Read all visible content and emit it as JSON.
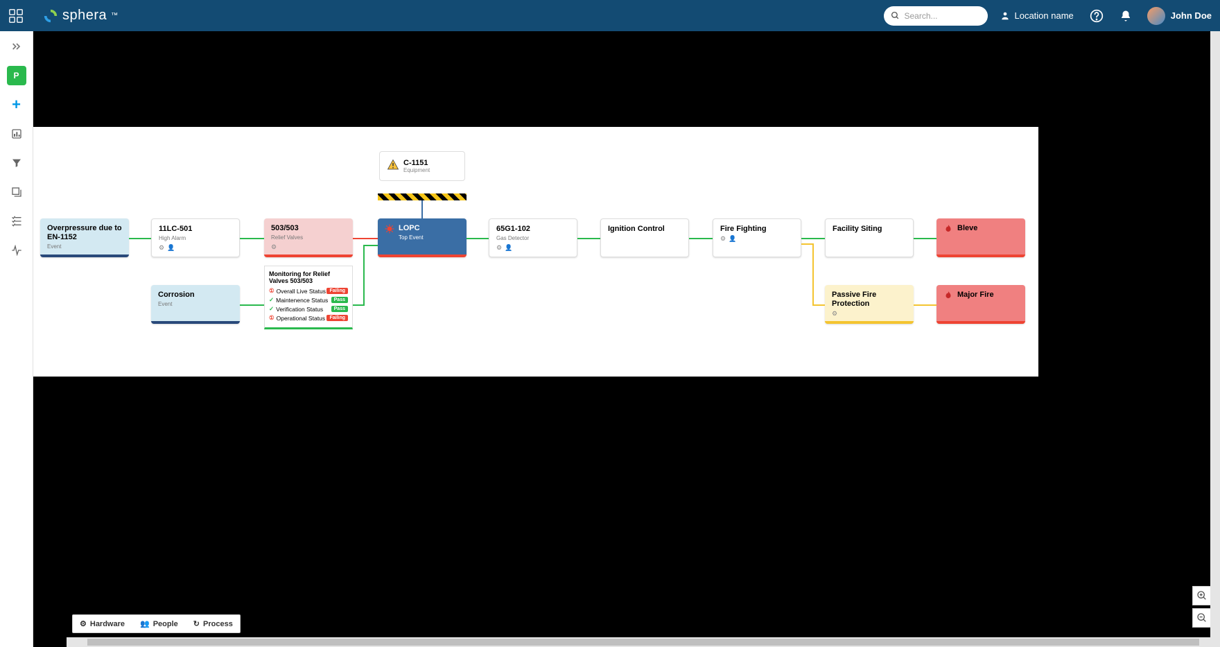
{
  "header": {
    "brand": "sphera",
    "search_placeholder": "Search...",
    "location": "Location name",
    "user": "John Doe"
  },
  "sidebar": {
    "p_label": "P"
  },
  "equipment": {
    "title": "C-1151",
    "subtitle": "Equipment"
  },
  "nodes": {
    "overpressure": {
      "title": "Overpressure due to EN-1152",
      "sub": "Event"
    },
    "hlc": {
      "title": "11LC-501",
      "sub": "High Alarm"
    },
    "relief": {
      "title": "503/503",
      "sub": "Relief Valves"
    },
    "lopc": {
      "title": "LOPC",
      "sub": "Top Event"
    },
    "gas": {
      "title": "65G1-102",
      "sub": "Gas Detector"
    },
    "ignition": {
      "title": "Ignition Control"
    },
    "firefight": {
      "title": "Fire Fighting"
    },
    "facility": {
      "title": "Facility Siting"
    },
    "bleve": {
      "title": "Bleve"
    },
    "corrosion": {
      "title": "Corrosion",
      "sub": "Event"
    },
    "passive": {
      "title": "Passive Fire Protection"
    },
    "majorfire": {
      "title": "Major Fire"
    }
  },
  "detail": {
    "title": "Monitoring for Relief Valves 503/503",
    "rows": [
      {
        "label": "Overall Live Status",
        "status": "Failing",
        "ok": false
      },
      {
        "label": "Maintenence Status",
        "status": "Pass",
        "ok": true
      },
      {
        "label": "Verification Status",
        "status": "Pass",
        "ok": true
      },
      {
        "label": "Operational Status",
        "status": "Failing",
        "ok": false
      }
    ]
  },
  "footer": {
    "hardware": "Hardware",
    "people": "People",
    "process": "Process"
  }
}
